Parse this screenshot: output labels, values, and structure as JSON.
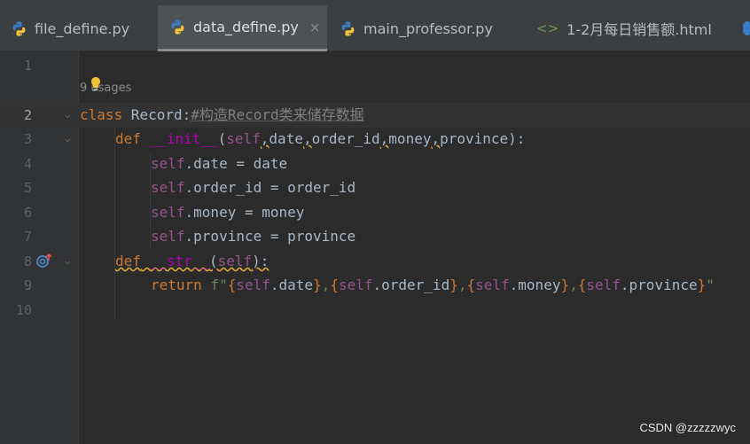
{
  "tabs": [
    {
      "label": "file_define.py",
      "icon": "python-icon"
    },
    {
      "label": "data_define.py",
      "icon": "python-icon",
      "active": true,
      "close": "×"
    },
    {
      "label": "main_professor.py",
      "icon": "python-icon"
    },
    {
      "label": "1-2月每日销售额.html",
      "icon": "html-code-icon",
      "glyph": "<>"
    }
  ],
  "editor": {
    "line_numbers": [
      "1",
      "2",
      "3",
      "4",
      "5",
      "6",
      "7",
      "8",
      "9",
      "10"
    ],
    "usages_hint": "9 usages",
    "lines": {
      "l2_kw": "class",
      "l2_name": " Record:",
      "l2_comment": "#构造Record类来储存数据",
      "l3_def": "def",
      "l3_fn": "__init__",
      "l3_p0": "(",
      "l3_self": "self",
      "l3_c1": ",",
      "l3_a1": "date",
      "l3_c2": ",",
      "l3_a2": "order_id",
      "l3_c3": ",",
      "l3_a3": "money",
      "l3_c4": ",",
      "l3_a4": "province",
      "l3_end": "):",
      "l4_self": "self",
      "l4_rest": ".date = date",
      "l5_self": "self",
      "l5_rest": ".order_id = order_id",
      "l6_self": "self",
      "l6_rest": ".money = money",
      "l7_self": "self",
      "l7_rest": ".province = province",
      "l8_def": "def",
      "l8_fn": "__str__",
      "l8_p0": "(",
      "l8_self": "self",
      "l8_end": "):",
      "l9_kw": "return",
      "l9_f": " f\"",
      "l9_b1": "{",
      "l9_s1": "self",
      "l9_a1": ".date",
      "l9_b2": "}",
      "l9_c1": ",",
      "l9_b3": "{",
      "l9_s2": "self",
      "l9_a2": ".order_id",
      "l9_b4": "}",
      "l9_c2": ",",
      "l9_b5": "{",
      "l9_s3": "self",
      "l9_a3": ".money",
      "l9_b6": "}",
      "l9_c3": ",",
      "l9_b7": "{",
      "l9_s4": "self",
      "l9_a4": ".province",
      "l9_b8": "}",
      "l9_q": "\""
    }
  },
  "watermark": "CSDN @zzzzzwyc",
  "colors": {
    "background": "#2b2b2b",
    "keyword": "#cc7832",
    "self": "#94558d",
    "string": "#6a8759"
  }
}
